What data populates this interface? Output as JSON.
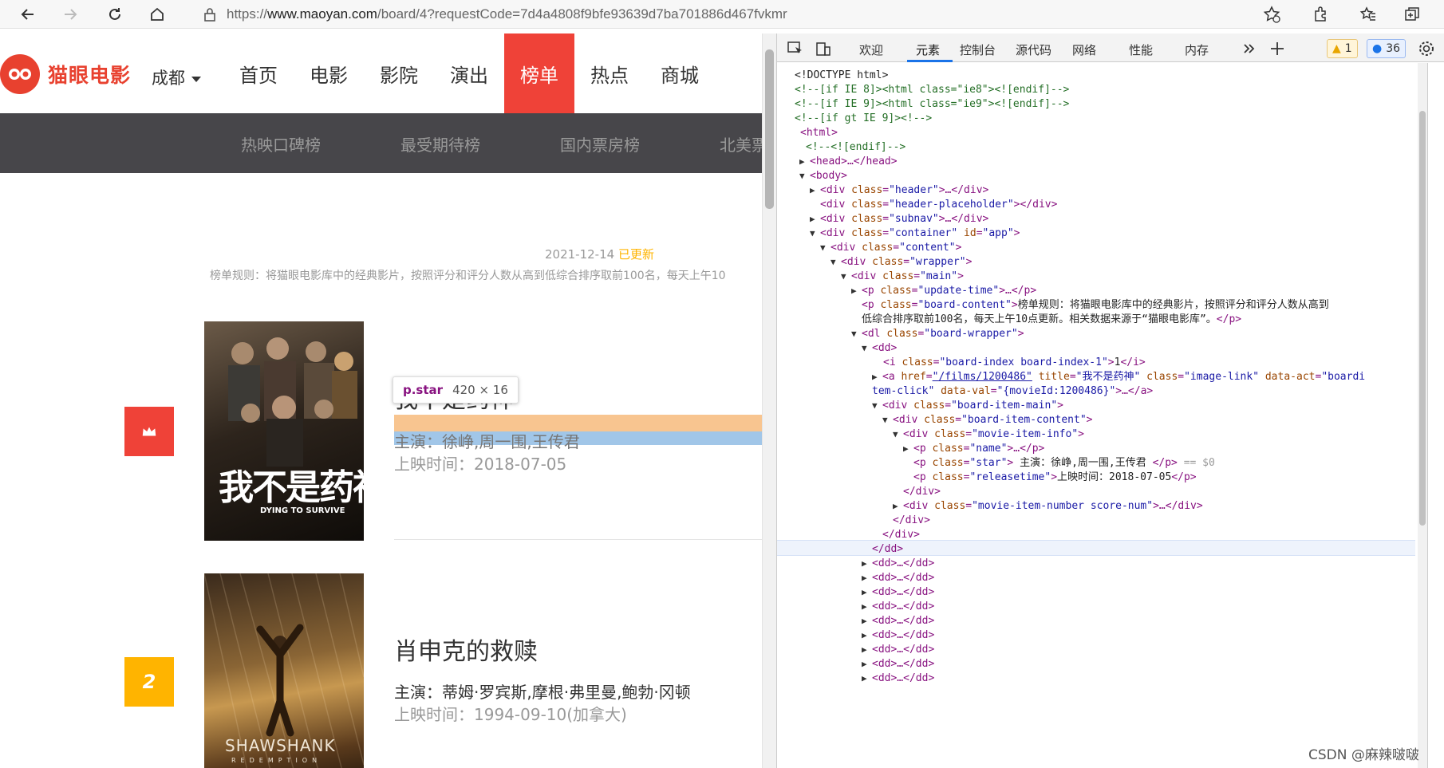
{
  "browser": {
    "url_prefix": "https://",
    "url_host": "www.maoyan.com",
    "url_path": "/board/4?requestCode=7d4a4808f9bfe93639d7ba701886d467fvkmr"
  },
  "site": {
    "logo_text": "猫眼电影",
    "city": "成都",
    "menu": [
      {
        "label": "首页"
      },
      {
        "label": "电影"
      },
      {
        "label": "影院"
      },
      {
        "label": "演出"
      },
      {
        "label": "榜单",
        "active": true
      },
      {
        "label": "热点"
      },
      {
        "label": "商城"
      }
    ],
    "subnav": [
      {
        "label": "热映口碑榜"
      },
      {
        "label": "最受期待榜"
      },
      {
        "label": "国内票房榜"
      },
      {
        "label": "北美票"
      }
    ]
  },
  "board": {
    "update_date": "2021-12-14",
    "update_status": "已更新",
    "rules": "榜单规则：将猫眼电影库中的经典影片，按照评分和评分人数从高到低综合排序取前100名，每天上午10",
    "movies": [
      {
        "index": "1",
        "name": "我不是药神",
        "star": "主演：徐峥,周一围,王传君",
        "release": "上映时间：2018-07-05",
        "poster_text": "我不是药神",
        "poster_sub": "DYING TO SURVIVE"
      },
      {
        "index": "2",
        "name": "肖申克的救赎",
        "star": "主演：蒂姆·罗宾斯,摩根·弗里曼,鲍勃·冈顿",
        "release": "上映时间：1994-09-10(加拿大)",
        "poster_text": "SHAWSHANK",
        "poster_sub": "REDEMPTION"
      }
    ]
  },
  "inspector_tooltip": {
    "tag": "p.star",
    "size": "420 × 16"
  },
  "devtools": {
    "tabs": [
      {
        "label": "欢迎"
      },
      {
        "label": "元素",
        "active": true
      },
      {
        "label": "控制台"
      },
      {
        "label": "源代码"
      },
      {
        "label": "网络"
      },
      {
        "label": "性能"
      },
      {
        "label": "内存"
      }
    ],
    "warning_count": "1",
    "message_count": "36"
  },
  "dom": {
    "doctype": "<!DOCTYPE html>",
    "c1": "<!--[if IE 8]><html class=\"ie8\"><![endif]-->",
    "c2": "<!--[if IE 9]><html class=\"ie9\"><![endif]-->",
    "c3": "<!--[if gt IE 9]><!-->",
    "html": "<html>",
    "c4": "<!--<![endif]-->",
    "head": "<head>…</head>",
    "body": "<body>",
    "div_header": "\"header\"",
    "div_header_placeholder": "\"header-placeholder\"",
    "div_subnav": "\"subnav\"",
    "div_container": "\"container\"",
    "div_container_id": "\"app\"",
    "div_content": "\"content\"",
    "div_wrapper": "\"wrapper\"",
    "div_main": "\"main\"",
    "p_update": "\"update-time\"",
    "p_board_content": "\"board-content\"",
    "board_text_1": "榜单规则：将猫眼电影库中的经典影片，按照评分和评分人数从高到",
    "board_text_2": "低综合排序取前100名，每天上午10点更新。相关数据来源于“猫眼电影库”。",
    "dl_board": "\"board-wrapper\"",
    "i_class": "\"board-index board-index-1\"",
    "i_text": "1",
    "a_href": "\"/films/1200486\"",
    "a_title": "\"我不是药神\"",
    "a_class": "\"image-link\"",
    "a_act_1": "\"boardi",
    "a_act_2": "tem-click\"",
    "a_val": "\"{movieId:1200486}\"",
    "div_board_main": "\"board-item-main\"",
    "div_board_content": "\"board-item-content\"",
    "div_movie_info": "\"movie-item-info\"",
    "p_name": "\"name\"",
    "p_star": "\"star\"",
    "p_star_text": " 主演：徐峥,周一围,王传君 ",
    "p_release": "\"releasetime\"",
    "p_release_text": "上映时间：2018-07-05",
    "div_number": "\"movie-item-number score-num\"",
    "dd_collapsed": "<dd>…</dd>",
    "selected_marker": "== $0"
  },
  "watermark": "CSDN @麻辣啵啵"
}
